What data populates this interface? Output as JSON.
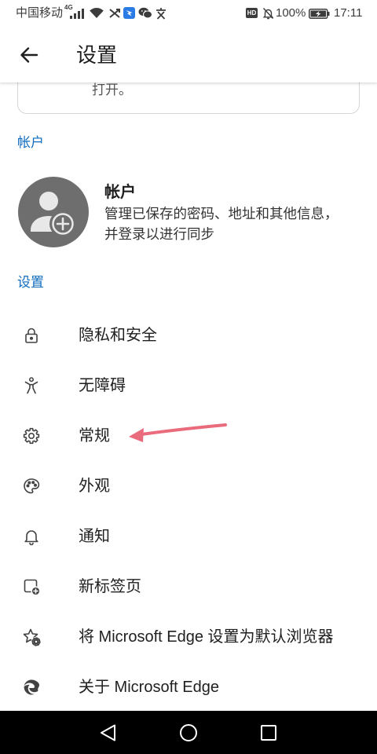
{
  "status_bar": {
    "carrier": "中国移动",
    "network_type": "4G",
    "hd_badge": "HD",
    "battery_level": "100%",
    "time": "17:11",
    "left_icons": [
      "signal-icon",
      "wifi-icon",
      "app-notification-icon",
      "dingtalk-icon",
      "wechat-icon",
      "app-notification-icon"
    ],
    "right_icons": [
      "bell-off-icon",
      "battery-charging-icon"
    ]
  },
  "header": {
    "back_icon": "arrow-left-icon",
    "title": "设置"
  },
  "top_card": {
    "text": "打开。"
  },
  "account_section": {
    "heading": "帐户",
    "avatar_icon": "add-account-icon",
    "title": "帐户",
    "description": [
      "管理已保存的密码、地址和其他信息，",
      "并登录以进行同步"
    ]
  },
  "settings_section": {
    "heading": "设置",
    "items": [
      {
        "label": "隐私和安全",
        "icon": "lock-icon"
      },
      {
        "label": "无障碍",
        "icon": "accessibility-icon"
      },
      {
        "label": "常规",
        "icon": "gear-icon"
      },
      {
        "label": "外观",
        "icon": "palette-icon"
      },
      {
        "label": "通知",
        "icon": "bell-icon"
      },
      {
        "label": "新标签页",
        "icon": "new-tab-icon"
      },
      {
        "label": "将 Microsoft Edge 设置为默认浏览器",
        "icon": "star-settings-icon"
      },
      {
        "label": "关于 Microsoft Edge",
        "icon": "edge-logo-icon"
      }
    ]
  },
  "nav_bar": {
    "icons": [
      "nav-back-icon",
      "nav-home-icon",
      "nav-recents-icon"
    ]
  },
  "colors": {
    "accent": "#0f6cbd",
    "text": "#1f1f1f",
    "icon": "#424242",
    "avatar": "#6e6e6e",
    "annotation_arrow": "#ea6b7c",
    "nav_bar": "#000000"
  }
}
